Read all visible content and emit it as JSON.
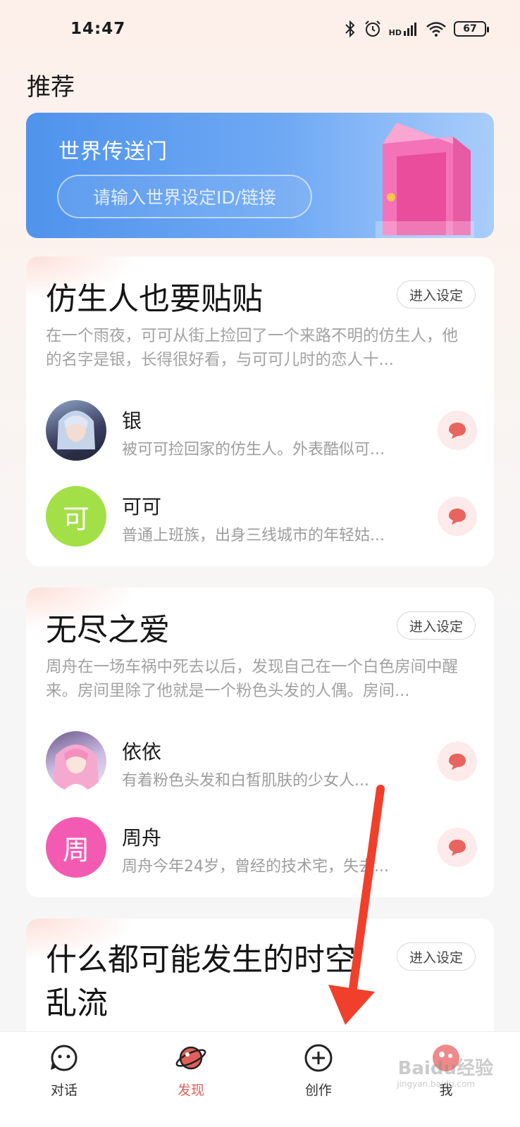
{
  "status_bar": {
    "time": "14:47",
    "signal_label": "HD",
    "battery": "67",
    "icons": [
      "bluetooth-icon",
      "alarm-icon",
      "signal-icon",
      "wifi-icon",
      "battery-icon"
    ]
  },
  "page_title": "推荐",
  "portal": {
    "title": "世界传送门",
    "input_placeholder": "请输入世界设定ID/链接"
  },
  "worlds": [
    {
      "title": "仿生人也要贴贴",
      "enter_label": "进入设定",
      "description": "在一个雨夜，可可从街上捡回了一个来路不明的仿生人，他的名字是银，长得很好看，与可可儿时的恋人十...",
      "characters": [
        {
          "name": "银",
          "desc": "被可可捡回家的仿生人。外表酷似可...",
          "avatar_type": "image"
        },
        {
          "name": "可可",
          "desc": "普通上班族，出身三线城市的年轻姑...",
          "avatar_letter": "可",
          "avatar_color": "#a3df46"
        }
      ]
    },
    {
      "title": "无尽之爱",
      "enter_label": "进入设定",
      "description": "周舟在一场车祸中死去以后，发现自己在一个白色房间中醒来。房间里除了他就是一个粉色头发的人偶。房间...",
      "characters": [
        {
          "name": "依依",
          "desc": "有着粉色头发和白皙肌肤的少女人...",
          "avatar_type": "image"
        },
        {
          "name": "周舟",
          "desc": "周舟今年24岁，曾经的技术宅，失去...",
          "avatar_letter": "周",
          "avatar_color": "#f35bb3"
        }
      ]
    },
    {
      "title": "什么都可能发生的时空乱流",
      "enter_label": "进入设定"
    }
  ],
  "tabbar": {
    "tabs": [
      {
        "label": "对话",
        "icon": "chat-face-icon"
      },
      {
        "label": "发现",
        "icon": "planet-icon",
        "active": true
      },
      {
        "label": "创作",
        "icon": "plus-circle-icon"
      },
      {
        "label": "我",
        "icon": "profile-avatar-icon"
      }
    ]
  },
  "watermark": {
    "text": "Baidu经验",
    "sub": "jingyan.baidu.com"
  },
  "colors": {
    "accent": "#e2605a",
    "portal_start": "#4f93ec",
    "portal_end": "#a9cdfb",
    "annotation_arrow": "#f0402b"
  }
}
